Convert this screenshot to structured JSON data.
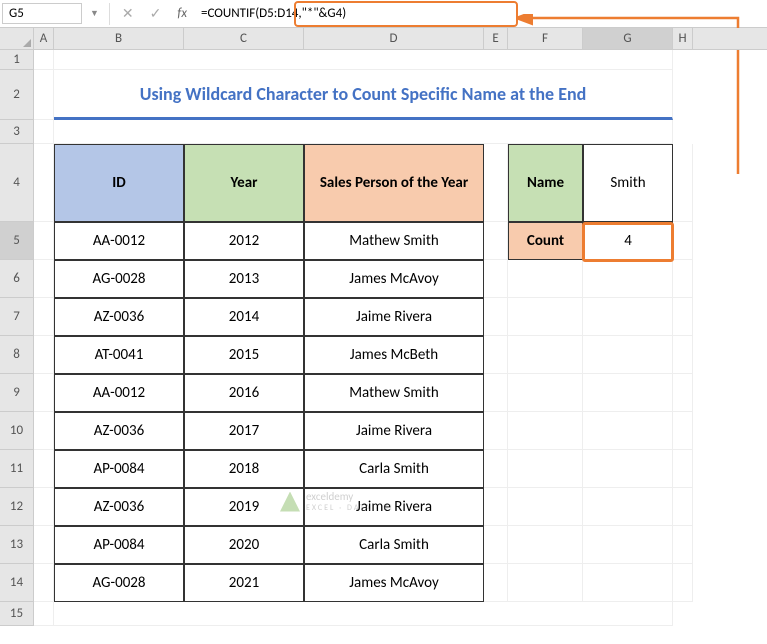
{
  "formula_bar": {
    "cell_ref": "G5",
    "formula": "=COUNTIF(D5:D14,\"*\"&G4)"
  },
  "columns": [
    "A",
    "B",
    "C",
    "D",
    "E",
    "F",
    "G",
    "H"
  ],
  "row_headers": [
    "1",
    "2",
    "3",
    "4",
    "5",
    "6",
    "7",
    "8",
    "9",
    "10",
    "11",
    "12",
    "13",
    "14",
    "15"
  ],
  "title": "Using Wildcard Character to Count Specific Name at the End",
  "headers": {
    "id": "ID",
    "year": "Year",
    "sales": "Sales Person of the Year",
    "name": "Name",
    "count": "Count"
  },
  "lookup": {
    "name_value": "Smith",
    "count_value": "4"
  },
  "table": [
    {
      "id": "AA-0012",
      "year": "2012",
      "sales": "Mathew Smith"
    },
    {
      "id": "AG-0028",
      "year": "2013",
      "sales": "James McAvoy"
    },
    {
      "id": "AZ-0036",
      "year": "2014",
      "sales": "Jaime Rivera"
    },
    {
      "id": "AT-0041",
      "year": "2015",
      "sales": "James McBeth"
    },
    {
      "id": "AA-0012",
      "year": "2016",
      "sales": "Mathew Smith"
    },
    {
      "id": "AZ-0036",
      "year": "2017",
      "sales": "Jaime Rivera"
    },
    {
      "id": "AP-0084",
      "year": "2018",
      "sales": "Carla Smith"
    },
    {
      "id": "AZ-0036",
      "year": "2019",
      "sales": "Jaime Rivera"
    },
    {
      "id": "AP-0084",
      "year": "2020",
      "sales": "Carla Smith"
    },
    {
      "id": "AG-0028",
      "year": "2021",
      "sales": "James McAvoy"
    }
  ],
  "watermark": {
    "name": "exceldemy",
    "sub": "EXCEL · DATA · BI"
  }
}
